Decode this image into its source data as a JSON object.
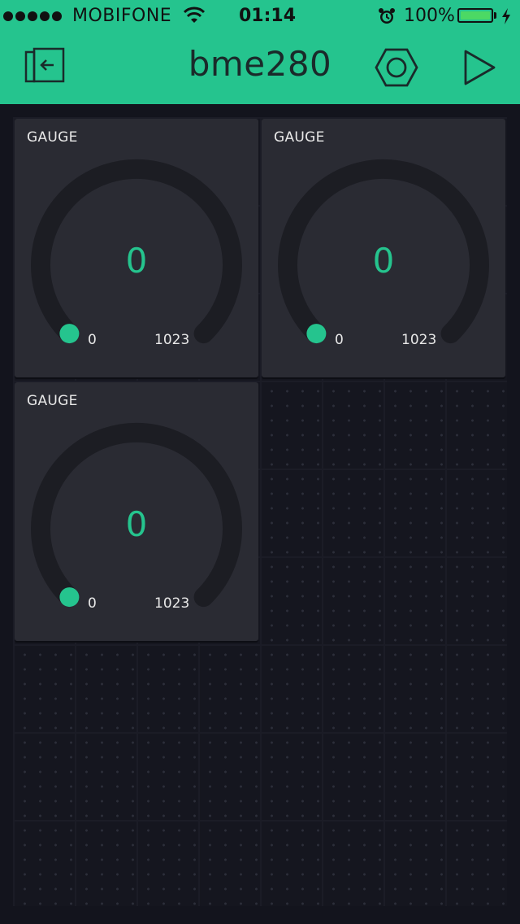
{
  "status_bar": {
    "carrier": "MOBIFONE",
    "time": "01:14",
    "battery_percent": "100%",
    "signal_bars": 5
  },
  "header": {
    "title": "bme280",
    "icons": [
      "back-icon",
      "settings-icon",
      "play-icon"
    ],
    "background_color": "#25c48e"
  },
  "widgets": [
    {
      "title": "GAUGE",
      "value": "0",
      "min": "0",
      "max": "1023",
      "fill_fraction": 0
    },
    {
      "title": "GAUGE",
      "value": "0",
      "min": "0",
      "max": "1023",
      "fill_fraction": 0
    },
    {
      "title": "GAUGE",
      "value": "0",
      "min": "0",
      "max": "1023",
      "fill_fraction": 0
    }
  ],
  "colors": {
    "accent": "#25c48e",
    "background": "#13141d",
    "widget_bg": "#2a2b33",
    "gauge_track": "#1b1c22"
  }
}
